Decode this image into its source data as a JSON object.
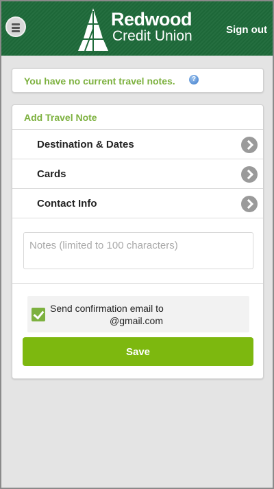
{
  "header": {
    "menu_icon": "menu-icon",
    "brand_name": "Redwood",
    "brand_sub": "Credit Union",
    "signout_label": "Sign out",
    "brand_color": "#1e6a3a"
  },
  "notice": {
    "text": "You have no current travel notes.",
    "help_icon": "help-icon",
    "help_glyph": "?"
  },
  "form": {
    "title": "Add Travel Note",
    "rows": [
      {
        "label": "Destination & Dates",
        "icon": "chevron-right-icon"
      },
      {
        "label": "Cards",
        "icon": "chevron-right-icon"
      },
      {
        "label": "Contact Info",
        "icon": "chevron-right-icon"
      }
    ],
    "notes_placeholder": "Notes (limited to 100 characters)",
    "notes_value": "",
    "confirm": {
      "checked": true,
      "line1": "Send confirmation email to",
      "line2": "@gmail.com"
    },
    "save_label": "Save"
  },
  "colors": {
    "accent_green": "#7db13f",
    "button_green": "#7db80f"
  }
}
